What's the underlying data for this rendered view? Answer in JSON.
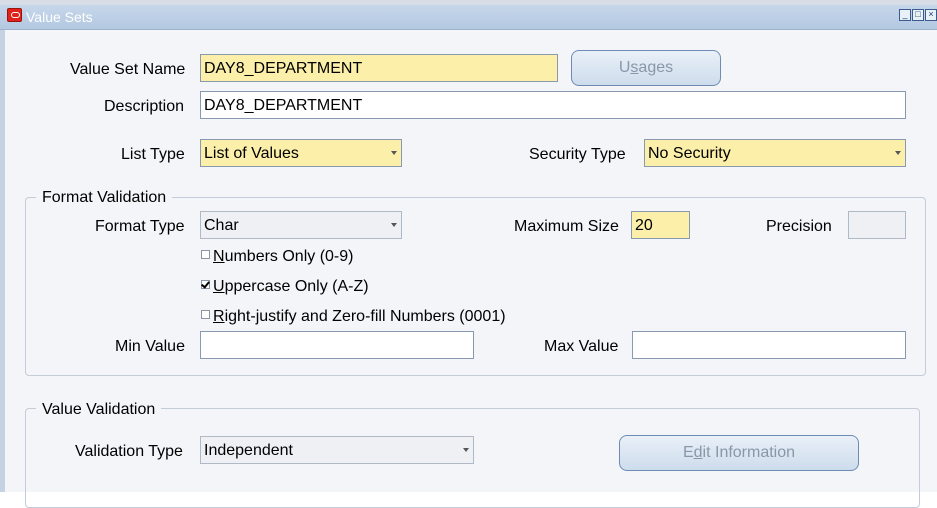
{
  "window": {
    "title": "Value Sets",
    "controls": [
      "minimize",
      "maximize",
      "close"
    ]
  },
  "value_set_name": {
    "label": "Value Set Name",
    "value": "DAY8_DEPARTMENT"
  },
  "usages_button": {
    "label_before": "U",
    "mnemonic": "s",
    "label_after": "ages"
  },
  "description": {
    "label": "Description",
    "value": "DAY8_DEPARTMENT"
  },
  "list_type": {
    "label": "List Type",
    "value": "List of Values"
  },
  "security_type": {
    "label": "Security Type",
    "value": "No Security"
  },
  "format_validation": {
    "title": "Format Validation",
    "format_type": {
      "label": "Format Type",
      "value": "Char"
    },
    "maximum_size": {
      "label": "Maximum Size",
      "value": "20"
    },
    "precision": {
      "label": "Precision",
      "value": ""
    },
    "numbers_only": {
      "mnemonic": "N",
      "rest": "umbers Only (0-9)",
      "checked": false
    },
    "uppercase_only": {
      "mnemonic": "U",
      "rest": "ppercase Only (A-Z)",
      "checked": true
    },
    "right_justify": {
      "mnemonic": "R",
      "rest": "ight-justify and Zero-fill Numbers (0001)",
      "checked": false
    },
    "min_value": {
      "label": "Min Value",
      "value": ""
    },
    "max_value": {
      "label": "Max Value",
      "value": ""
    }
  },
  "value_validation": {
    "title": "Value Validation",
    "validation_type": {
      "label": "Validation Type",
      "value": "Independent"
    },
    "edit_information_button": {
      "label_before": "E",
      "mnemonic": "d",
      "label_after": "it Information"
    }
  },
  "colors": {
    "required": "#fbefa9",
    "titlebar": "#b3c8e1",
    "background": "#f3f5f8"
  }
}
